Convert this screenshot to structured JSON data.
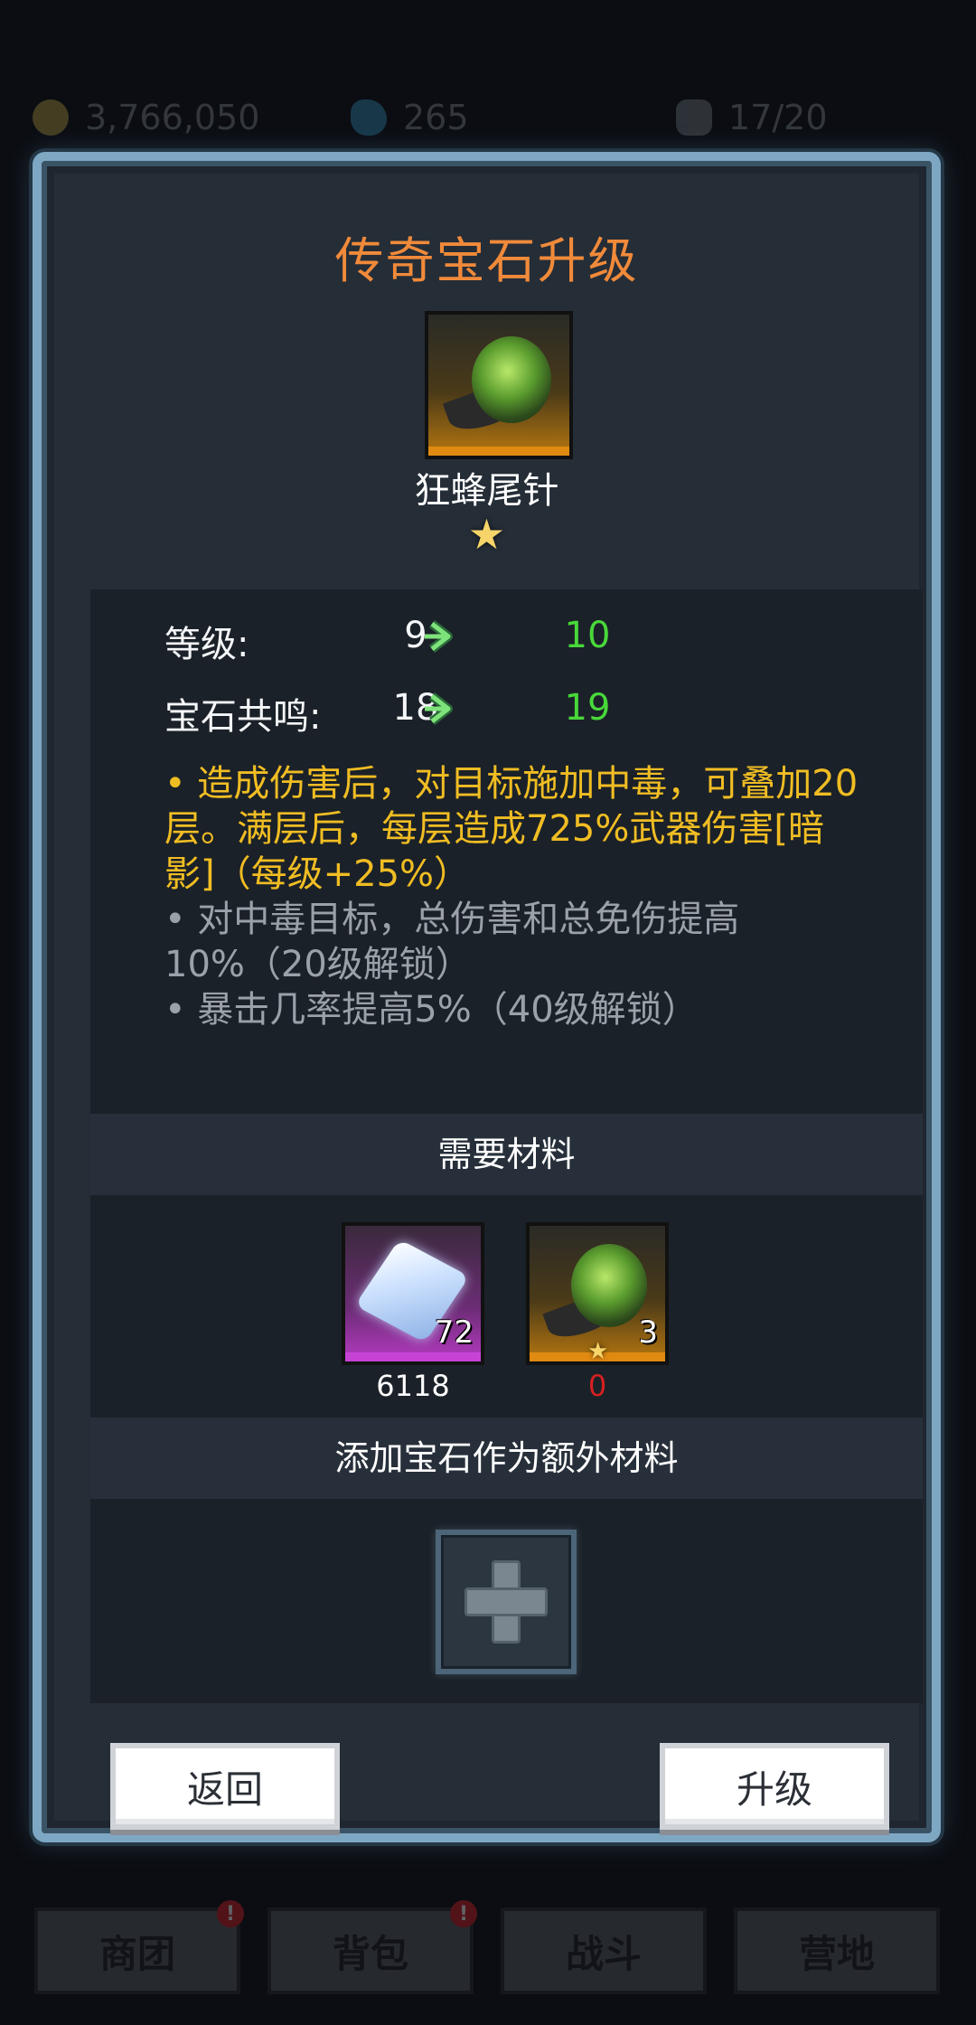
{
  "topbar": {
    "gold": "3,766,050",
    "gems": "265",
    "energy": "17/20",
    "colors": {
      "gold": "#d6b84a",
      "gem": "#3aa6d6",
      "energy": "#8a9199"
    }
  },
  "dialog": {
    "title": "传奇宝石升级",
    "item": {
      "name": "狂蜂尾针",
      "stars": "★",
      "icon": "hornet-stinger-gem-icon"
    },
    "stats": [
      {
        "label": "等级:",
        "current": "9",
        "next": "10"
      },
      {
        "label": "宝石共鸣:",
        "current": "18",
        "next": "19"
      }
    ],
    "description": {
      "main": "• 造成伤害后，对目标施加中毒，可叠加20层。满层后，每层造成725%武器伤害[暗影]（每级+25%）",
      "locked_1": "• 对中毒目标，总伤害和总免伤提高10%（20级解锁）",
      "locked_2": "• 暴击几率提高5%（40级解锁）"
    },
    "materials": {
      "header": "需要材料",
      "items": [
        {
          "icon": "ice-cube-icon",
          "count": "72",
          "owned": "6118"
        },
        {
          "icon": "hornet-stinger-gem-icon",
          "count": "3",
          "star": "★",
          "owned": "0"
        }
      ]
    },
    "extra": {
      "header": "添加宝石作为额外材料",
      "add_icon": "plus-icon"
    },
    "buttons": {
      "back": "返回",
      "upgrade": "升级"
    },
    "colors": {
      "title": "#f08a3a",
      "next_value": "#48d83a",
      "desc_main": "#f0bd23",
      "desc_locked": "#9aa1a9",
      "owned_zero": "#d62020"
    }
  },
  "bottom_nav": [
    {
      "label": "商团",
      "badge": "!"
    },
    {
      "label": "背包",
      "badge": "!"
    },
    {
      "label": "战斗"
    },
    {
      "label": "营地"
    }
  ]
}
